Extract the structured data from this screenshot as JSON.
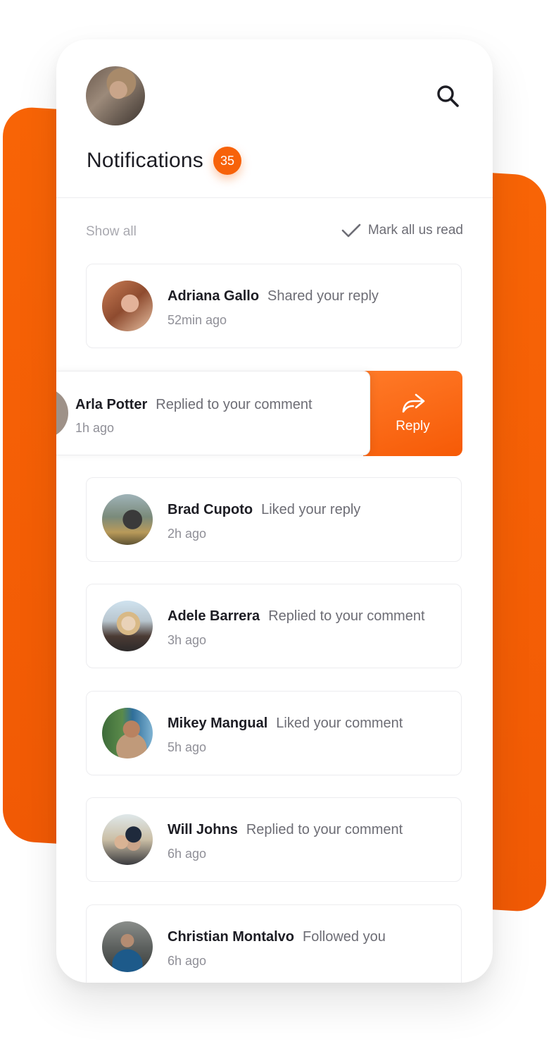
{
  "header": {
    "title": "Notifications",
    "badge_count": "35"
  },
  "filters": {
    "show_all": "Show all",
    "mark_all_read": "Mark all us read"
  },
  "notifications": [
    {
      "name": "Adriana Gallo",
      "action": "Shared your reply",
      "time": "52min ago"
    },
    {
      "name": "Arla Potter",
      "action": "Replied to your comment",
      "time": "1h ago"
    },
    {
      "name": "Brad Cupoto",
      "action": "Liked your reply",
      "time": "2h ago"
    },
    {
      "name": "Adele Barrera",
      "action": "Replied to your comment",
      "time": "3h ago"
    },
    {
      "name": "Mikey Mangual",
      "action": "Liked your comment",
      "time": "5h ago"
    },
    {
      "name": "Will Johns",
      "action": "Replied to your comment",
      "time": "6h ago"
    },
    {
      "name": "Christian Montalvo",
      "action": "Followed you",
      "time": "6h ago"
    }
  ],
  "swipe_action": {
    "label": "Reply",
    "icon": "share-arrow-icon"
  },
  "colors": {
    "accent": "#f65c06",
    "text_dark": "#1d1d24",
    "text_muted": "#8f8f97"
  }
}
